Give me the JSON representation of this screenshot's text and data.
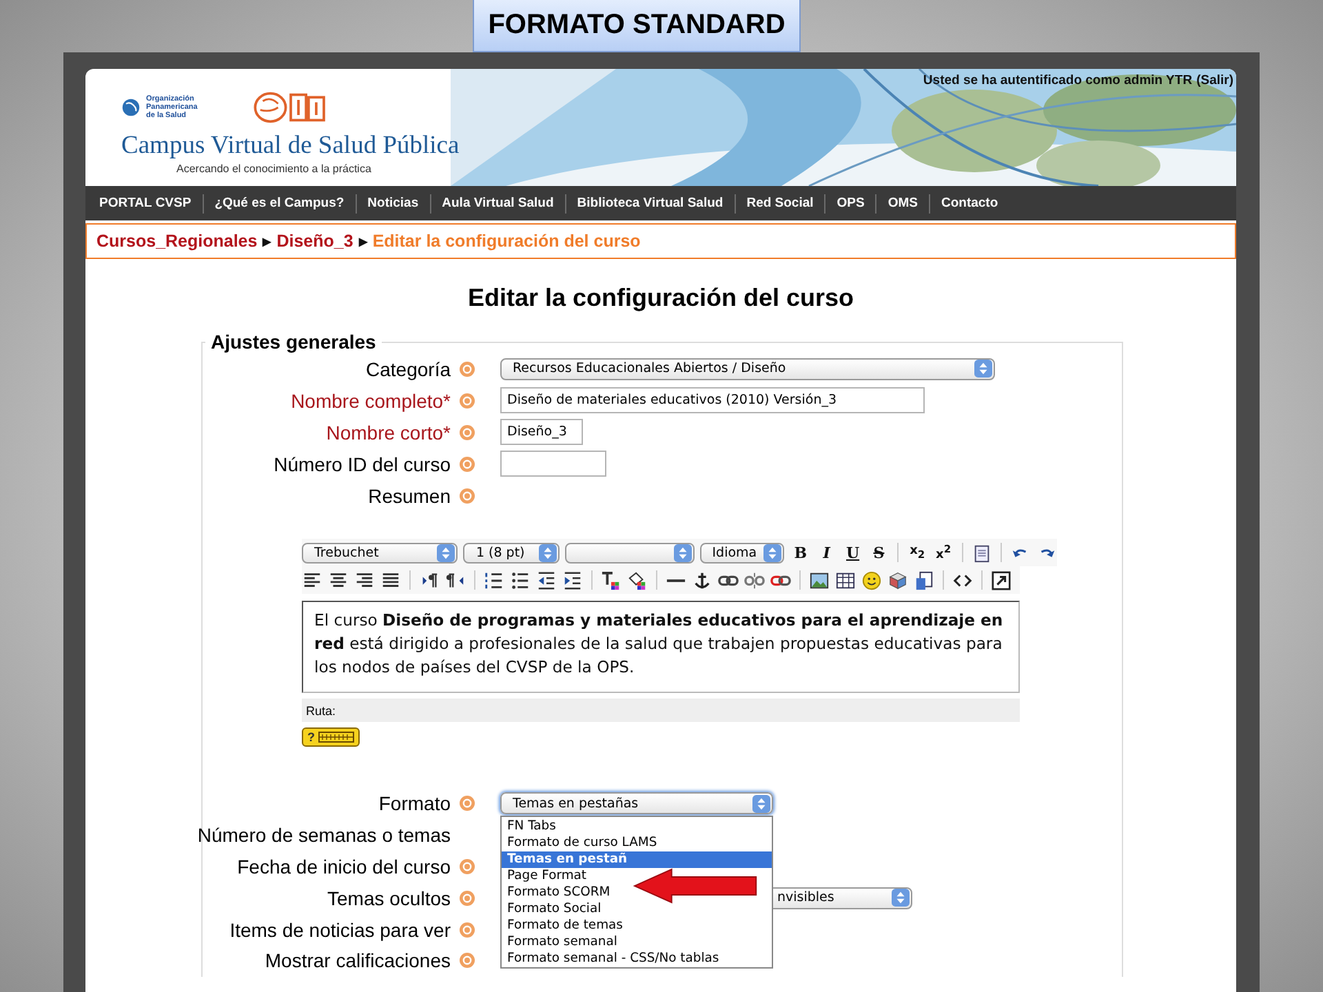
{
  "slide_label": "FORMATO STANDARD",
  "header": {
    "org_name": "Organización Panamericana de la Salud",
    "site_title": "Campus Virtual de Salud Pública",
    "tagline": "Acercando el conocimiento a la práctica",
    "login_text": "Usted se ha autentificado como admin YTR",
    "logout_link": "(Salir)"
  },
  "nav": [
    "PORTAL CVSP",
    "¿Qué es el Campus?",
    "Noticias",
    "Aula Virtual Salud",
    "Biblioteca Virtual Salud",
    "Red Social",
    "OPS",
    "OMS",
    "Contacto"
  ],
  "breadcrumb": {
    "separator": "▶",
    "items": [
      {
        "label": "Cursos_Regionales",
        "kind": "link"
      },
      {
        "label": "Diseño_3",
        "kind": "link"
      },
      {
        "label": "Editar la configuración del curso",
        "kind": "current"
      }
    ]
  },
  "page_title": "Editar la configuración del curso",
  "fieldset": {
    "legend": "Ajustes generales",
    "fields": [
      {
        "label": "Categoría",
        "required": false,
        "help": true,
        "kind": "select",
        "value": "Recursos Educacionales Abiertos / Diseño"
      },
      {
        "label": "Nombre completo*",
        "required": true,
        "help": true,
        "kind": "text",
        "value": "Diseño de materiales educativos (2010) Versión_3"
      },
      {
        "label": "Nombre corto*",
        "required": true,
        "help": true,
        "kind": "text",
        "value": "Diseño_3"
      },
      {
        "label": "Número ID del curso",
        "required": false,
        "help": true,
        "kind": "text"
      },
      {
        "label": "Resumen",
        "required": false,
        "help": true,
        "kind": "none"
      }
    ],
    "editor": {
      "selects": [
        "Trebuchet",
        "1 (8 pt)",
        "Idioma"
      ],
      "format_buttons": [
        {
          "text": "B",
          "kind": "bold"
        },
        {
          "text": "I",
          "kind": "italic"
        },
        {
          "text": "U",
          "kind": "underline"
        },
        {
          "text": "S",
          "kind": "strike"
        }
      ],
      "script_buttons": [
        "x$_{2}$",
        "x$^{2}$"
      ],
      "content": "El curso **Diseño de programas y materiales educativos para el aprendizaje en red** está dirigido a profesionales de la salud que trabajen propuestas educativas para los nodos de países del CVSP de la OPS.",
      "path_label": "Ruta:",
      "help_badge": "?"
    },
    "more_fields": [
      {
        "label": "Formato",
        "help": true,
        "kind": "dropdown",
        "value": "Temas en pestañas",
        "options": [
          {
            "label": "FN Tabs",
            "selected": false
          },
          {
            "label": "Formato de curso LAMS",
            "selected": false
          },
          {
            "label": "Temas en pestañ",
            "selected": true
          },
          {
            "label": "Page Format",
            "selected": false
          },
          {
            "label": "Formato SCORM",
            "selected": false
          },
          {
            "label": "Formato Social",
            "selected": false
          },
          {
            "label": "Formato de temas",
            "selected": false
          },
          {
            "label": "Formato semanal",
            "selected": false
          },
          {
            "label": "Formato semanal - CSS/No tablas",
            "selected": false
          }
        ]
      },
      {
        "label": "Número de semanas o temas",
        "help": false,
        "kind": "covered"
      },
      {
        "label": "Fecha de inicio del curso",
        "help": true,
        "kind": "covered"
      },
      {
        "label": "Temas ocultos",
        "help": true,
        "kind": "select",
        "value": "nvisibles"
      },
      {
        "label": "Items de noticias para ver",
        "help": true,
        "kind": "covered"
      },
      {
        "label": "Mostrar calificaciones",
        "help": true,
        "kind": "covered"
      }
    ]
  }
}
